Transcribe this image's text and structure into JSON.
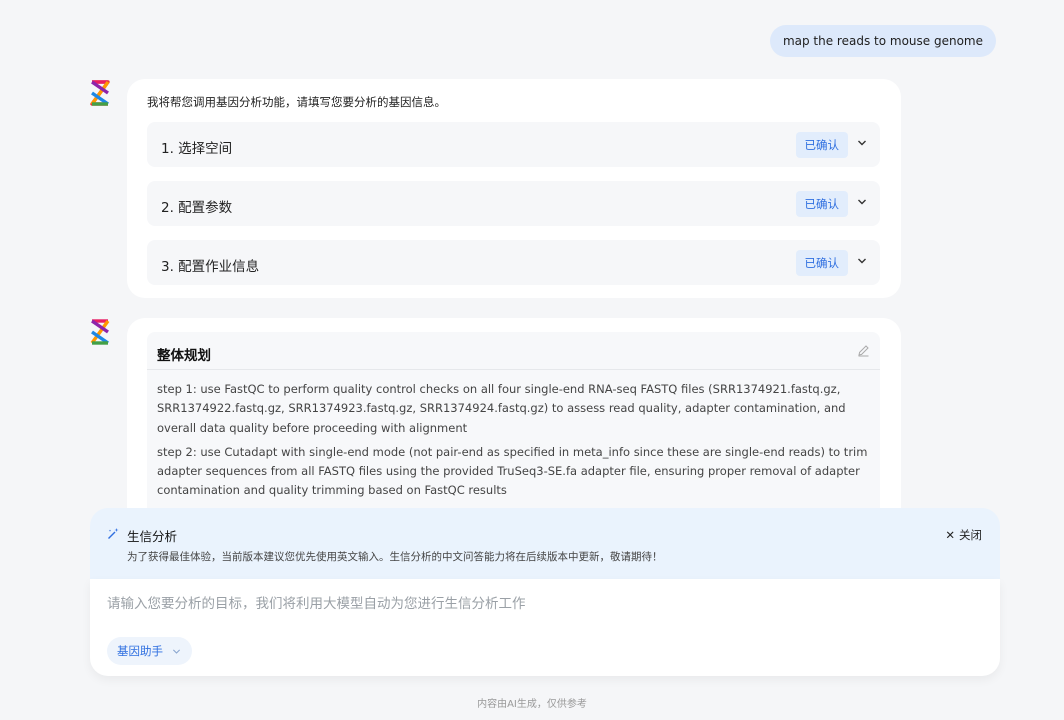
{
  "user_message": "map the reads to mouse genome",
  "colors": {
    "accent": "#2f6fe0",
    "badge_bg": "#e2edfc",
    "background": "#f5f6f8",
    "user_bubble": "#dde9fb"
  },
  "messages": [
    {
      "intro": "我将帮您调用基因分析功能，请填写您要分析的基因信息。",
      "steps": [
        {
          "title": "1. 选择空间",
          "status": "已确认"
        },
        {
          "title": "2. 配置参数",
          "status": "已确认"
        },
        {
          "title": "3. 配置作业信息",
          "status": "已确认"
        }
      ]
    },
    {
      "plan": {
        "title": "整体规划",
        "steps": [
          "step 1: use FastQC to perform quality control checks on all four single-end RNA-seq FASTQ files (SRR1374921.fastq.gz, SRR1374922.fastq.gz, SRR1374923.fastq.gz, SRR1374924.fastq.gz) to assess read quality, adapter contamination, and overall data quality before proceeding with alignment",
          "step 2: use Cutadapt with single-end mode (not pair-end as specified in meta_info since these are single-end reads) to trim adapter sequences from all FASTQ files using the provided TruSeq3-SE.fa adapter file, ensuring proper removal of adapter contamination and quality trimming based on FastQC results"
        ]
      }
    }
  ],
  "notice": {
    "title": "生信分析",
    "subtitle": "为了获得最佳体验，当前版本建议您优先使用英文输入。生信分析的中文问答能力将在后续版本中更新，敬请期待！",
    "close_label": "关闭"
  },
  "input": {
    "placeholder": "请输入您要分析的目标，我们将利用大模型自动为您进行生信分析工作",
    "value": ""
  },
  "assistant_button": "基因助手",
  "footer": "内容由AI生成，仅供参考",
  "icons": {
    "avatar": "logo-icon",
    "chevron": "chevron-down-icon",
    "edit": "edit-icon",
    "notice": "magic-wand-icon",
    "close": "close-icon"
  }
}
